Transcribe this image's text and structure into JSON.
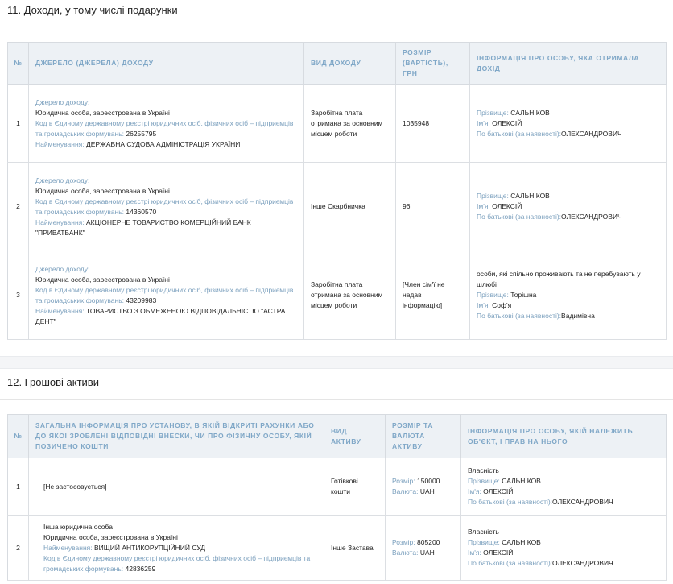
{
  "section11": {
    "title": "11. Доходи, у тому числі подарунки",
    "headers": {
      "num": "№",
      "source": "ДЖЕРЕЛО (ДЖЕРЕЛА) ДОХОДУ",
      "type": "ВИД ДОХОДУ",
      "amount": "РОЗМІР (ВАРТІСТЬ), ГРН",
      "person": "ІНФОРМАЦІЯ ПРО ОСОБУ, ЯКА ОТРИМАЛА ДОХІД"
    },
    "rows": [
      {
        "num": "1",
        "src_label": "Джерело доходу:",
        "src_kind": "Юридична особа, зареєстрована в Україні",
        "code_label": "Код в Єдиному державному реєстрі юридичних осіб, фізичних осіб – підприємців та громадських формувань:",
        "code": "26255795",
        "name_label": "Найменування:",
        "name": "ДЕРЖАВНА СУДОВА АДМІНІСТРАЦІЯ УКРАЇНИ",
        "type": "Заробітна плата отримана за основним місцем роботи",
        "amount": "1035948",
        "person_prefix": "",
        "surname_label": "Прізвище:",
        "surname": "САЛЬНІКОВ",
        "firstname_label": "Ім'я:",
        "firstname": "ОЛЕКСІЙ",
        "patronymic_label": "По батькові (за наявності):",
        "patronymic": "ОЛЕКСАНДРОВИЧ"
      },
      {
        "num": "2",
        "src_label": "Джерело доходу:",
        "src_kind": "Юридична особа, зареєстрована в Україні",
        "code_label": "Код в Єдиному державному реєстрі юридичних осіб, фізичних осіб – підприємців та громадських формувань:",
        "code": "14360570",
        "name_label": "Найменування:",
        "name": "АКЦІОНЕРНЕ ТОВАРИСТВО КОМЕРЦІЙНИЙ БАНК \"ПРИВАТБАНК\"",
        "type": "Інше Скарбничка",
        "amount": "96",
        "person_prefix": "",
        "surname_label": "Прізвище:",
        "surname": "САЛЬНІКОВ",
        "firstname_label": "Ім'я:",
        "firstname": "ОЛЕКСІЙ",
        "patronymic_label": "По батькові (за наявності):",
        "patronymic": "ОЛЕКСАНДРОВИЧ"
      },
      {
        "num": "3",
        "src_label": "Джерело доходу:",
        "src_kind": "Юридична особа, зареєстрована в Україні",
        "code_label": "Код в Єдиному державному реєстрі юридичних осіб, фізичних осіб – підприємців та громадських формувань:",
        "code": "43209983",
        "name_label": "Найменування:",
        "name": "ТОВАРИСТВО З ОБМЕЖЕНОЮ ВІДПОВІДАЛЬНІСТЮ \"АСТРА ДЕНТ\"",
        "type": "Заробітна плата отримана за основним місцем роботи",
        "amount": "[Член сім'ї не надав інформацію]",
        "person_prefix": "особи, які спільно проживають та не перебувають у шлюбі",
        "surname_label": "Прізвище:",
        "surname": "Торішна",
        "firstname_label": "Ім'я:",
        "firstname": "Соф'я",
        "patronymic_label": "По батькові (за наявності):",
        "patronymic": "Вадимівна"
      }
    ]
  },
  "section12": {
    "title": "12. Грошові активи",
    "headers": {
      "num": "№",
      "institution": "ЗАГАЛЬНА ІНФОРМАЦІЯ ПРО УСТАНОВУ, В ЯКІЙ ВІДКРИТІ РАХУНКИ АБО ДО ЯКОЇ ЗРОБЛЕНІ ВІДПОВІДНІ ВНЕСКИ, ЧИ ПРО ФІЗИЧНУ ОСОБУ, ЯКІЙ ПОЗИЧЕНО КОШТИ",
      "asset_type": "ВИД АКТИВУ",
      "amount": "РОЗМІР ТА ВАЛЮТА АКТИВУ",
      "owner": "ІНФОРМАЦІЯ ПРО ОСОБУ, ЯКІЙ НАЛЕЖИТЬ ОБ'ЄКТ, І ПРАВ НА НЬОГО"
    },
    "rows": [
      {
        "num": "1",
        "inst_text": "[Не застосовується]",
        "inst_kind2": "",
        "name_label": "",
        "name": "",
        "code_label": "",
        "code": "",
        "asset_type": "Готівкові кошти",
        "size_label": "Розмір:",
        "size": "150000",
        "currency_label": "Валюта:",
        "currency": "UAH",
        "ownership": "Власність",
        "surname_label": "Прізвище:",
        "surname": "САЛЬНІКОВ",
        "firstname_label": "Ім'я:",
        "firstname": "ОЛЕКСІЙ",
        "patronymic_label": "По батькові (за наявності):",
        "patronymic": "ОЛЕКСАНДРОВИЧ"
      },
      {
        "num": "2",
        "inst_text": "Інша юридична особа",
        "inst_kind2": "Юридична особа, зареєстрована в Україні",
        "name_label": "Найменування:",
        "name": "ВИЩИЙ АНТИКОРУПЦІЙНИЙ СУД",
        "code_label": "Код в Єдиному державному реєстрі юридичних осіб, фізичних осіб – підприємців та громадських формувань:",
        "code": "42836259",
        "asset_type": "Інше Застава",
        "size_label": "Розмір:",
        "size": "805200",
        "currency_label": "Валюта:",
        "currency": "UAH",
        "ownership": "Власність",
        "surname_label": "Прізвище:",
        "surname": "САЛЬНІКОВ",
        "firstname_label": "Ім'я:",
        "firstname": "ОЛЕКСІЙ",
        "patronymic_label": "По батькові (за наявності):",
        "patronymic": "ОЛЕКСАНДРОВИЧ"
      }
    ]
  }
}
